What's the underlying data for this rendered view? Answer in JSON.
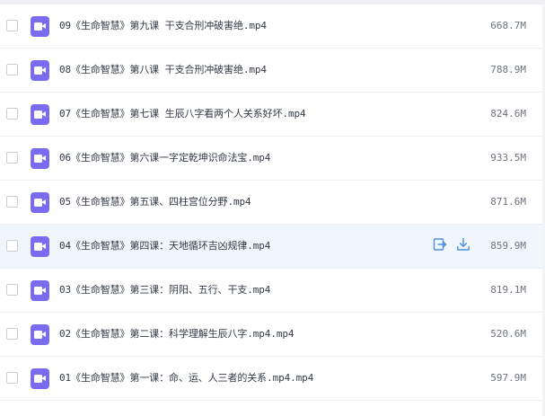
{
  "files": [
    {
      "name": "09《生命智慧》第九课 干支合刑冲破害绝.mp4",
      "size": "668.7M"
    },
    {
      "name": "08《生命智慧》第八课 干支合刑冲破害绝.mp4",
      "size": "788.9M"
    },
    {
      "name": "07《生命智慧》第七课 生辰八字看两个人关系好坏.mp4",
      "size": "824.6M"
    },
    {
      "name": "06《生命智慧》第六课一字定乾坤识命法宝.mp4",
      "size": "933.5M"
    },
    {
      "name": "05《生命智慧》第五课、四柱宫位分野.mp4",
      "size": "871.6M"
    },
    {
      "name": "04《生命智慧》第四课：天地循环吉凶规律.mp4",
      "size": "859.9M"
    },
    {
      "name": "03《生命智慧》第三课：阴阳、五行、干支.mp4",
      "size": "819.1M"
    },
    {
      "name": "02《生命智慧》第二课：科学理解生辰八字.mp4.mp4",
      "size": "520.6M"
    },
    {
      "name": "01《生命智慧》第一课：命、运、人三者的关系.mp4.mp4",
      "size": "597.9M"
    }
  ],
  "row_actions": {
    "icons": [
      "share-icon",
      "download-icon"
    ],
    "hovered_row": 5
  },
  "colors": {
    "video_icon": "#7a6cf0",
    "action_icon": "#4a90e2",
    "hover_row": "#f1f6fd"
  }
}
